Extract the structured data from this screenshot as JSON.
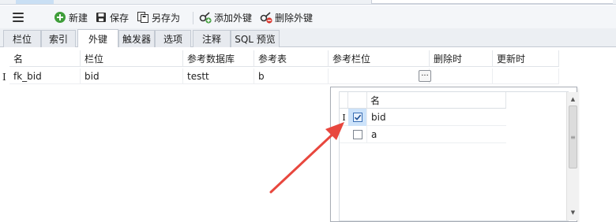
{
  "toolbar": {
    "new_label": "新建",
    "save_label": "保存",
    "save_as_label": "另存为",
    "add_fk_label": "添加外键",
    "delete_fk_label": "删除外键"
  },
  "tabs": [
    {
      "label": "栏位"
    },
    {
      "label": "索引"
    },
    {
      "label": "外键",
      "active": true
    },
    {
      "label": "触发器"
    },
    {
      "label": "选项"
    },
    {
      "label": "注释"
    },
    {
      "label": "SQL 预览"
    }
  ],
  "grid": {
    "columns": [
      "名",
      "栏位",
      "参考数据库",
      "参考表",
      "参考栏位",
      "删除时",
      "更新时"
    ],
    "rows": [
      {
        "name": "fk_bid",
        "field": "bid",
        "ref_db": "testt",
        "ref_table": "b",
        "ref_field": "",
        "on_delete": "",
        "on_update": ""
      }
    ],
    "row_indicator": "I",
    "ellipsis": "···"
  },
  "popup": {
    "header": "名",
    "row_indicator": "I",
    "items": [
      {
        "label": "bid",
        "checked": true,
        "selected": true
      },
      {
        "label": "a",
        "checked": false,
        "selected": false
      }
    ]
  },
  "colors": {
    "accent": "#e8473e",
    "selection": "#cde3fa"
  }
}
